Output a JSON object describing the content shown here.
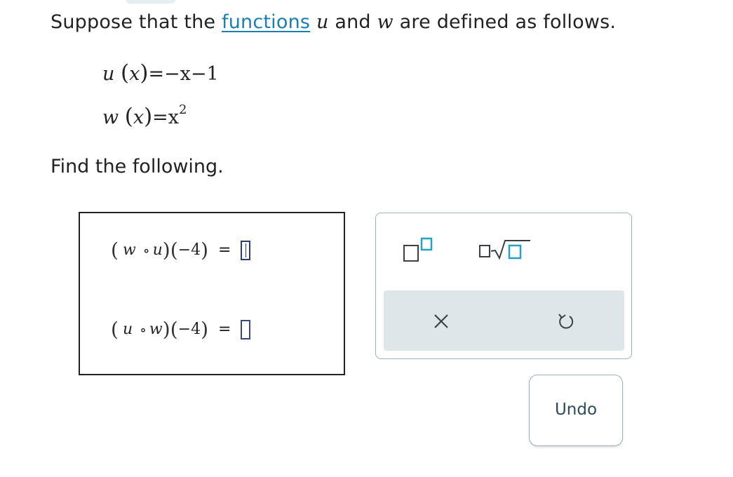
{
  "intro": {
    "before": "Suppose that the ",
    "link": "functions",
    "mid1": " ",
    "var1": "u",
    "mid2": " and ",
    "var2": "w",
    "after": " are defined as follows."
  },
  "definitions": [
    {
      "fn": "u",
      "arg": "x",
      "rhs": "=−x−1",
      "sup": ""
    },
    {
      "fn": "w",
      "arg": "x",
      "rhs": "=x",
      "sup": "2"
    }
  ],
  "find_text": "Find the following.",
  "questions": [
    {
      "outer": "w",
      "inner": "u",
      "arg": "−4",
      "equals": "=",
      "answer": ""
    },
    {
      "outer": "u",
      "inner": "w",
      "arg": "−4",
      "equals": "=",
      "answer": ""
    }
  ],
  "palette": {
    "superscript": "superscript-template",
    "radical": "radical-template",
    "clear": "clear",
    "undo": "undo"
  },
  "tooltip": {
    "label": "Undo"
  },
  "colors": {
    "link": "#1a7fb5",
    "palette_border": "#9db2c0",
    "palette_row_bg": "#dfe6ea",
    "answer_slot": "#2b3c7a"
  }
}
